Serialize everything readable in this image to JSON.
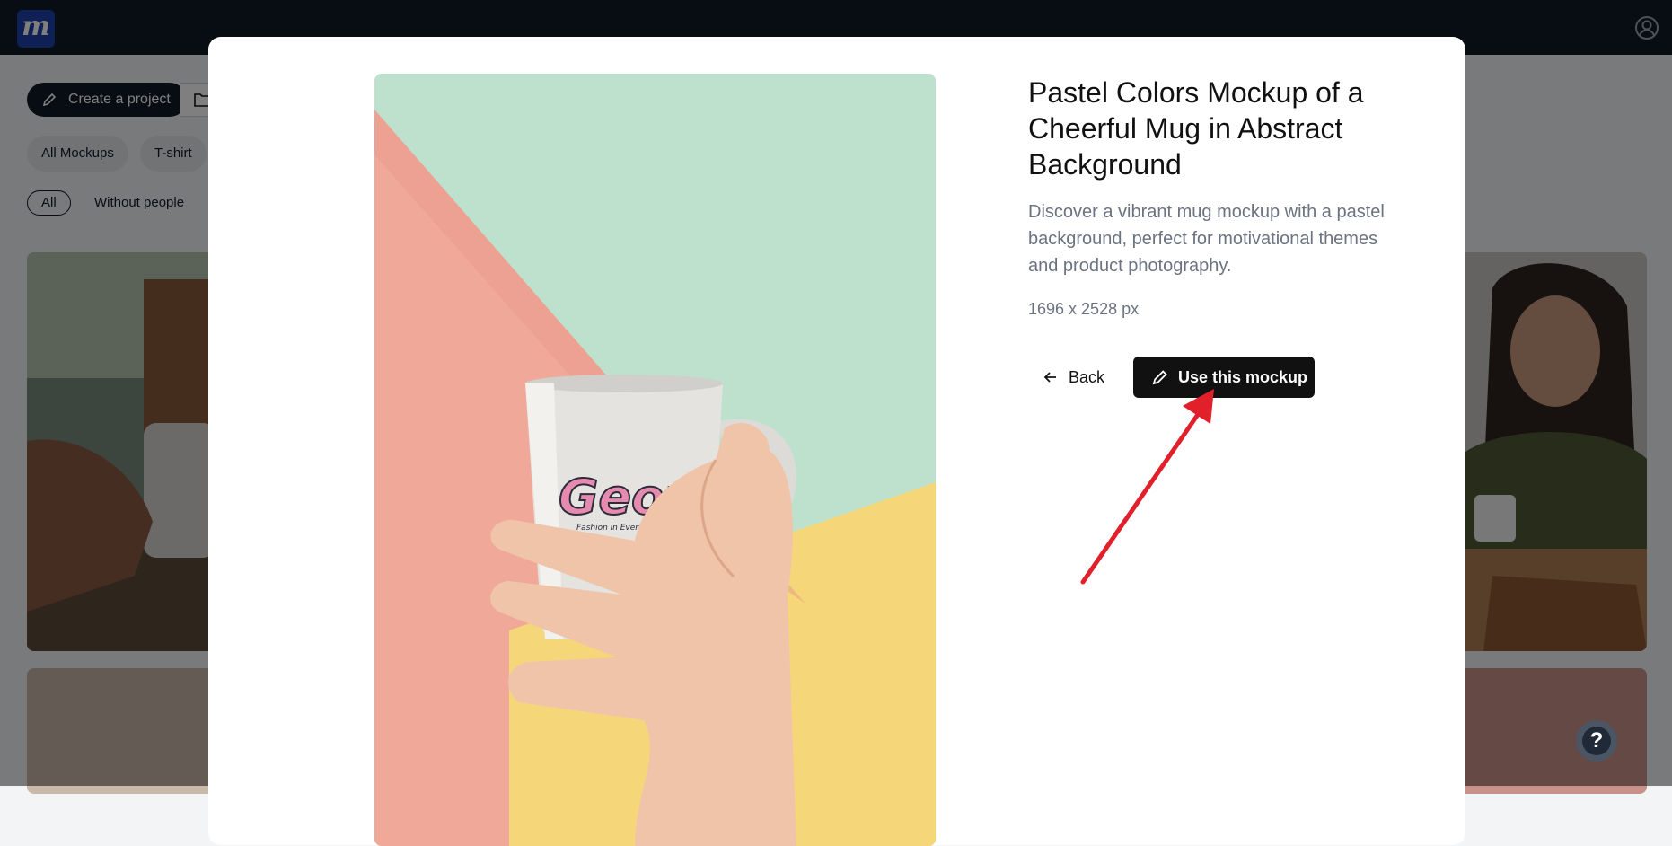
{
  "toolbar": {
    "create_project_label": "Create a project"
  },
  "categories": [
    {
      "label": "All Mockups"
    },
    {
      "label": "T-shirt"
    }
  ],
  "filters": [
    {
      "label": "All",
      "active": true
    },
    {
      "label": "Without people",
      "active": false
    }
  ],
  "modal": {
    "title": "Pastel Colors Mockup of a Cheerful Mug in Abstract Background",
    "description": "Discover a vibrant mug mockup with a pastel background, perfect for motivational themes and product photography.",
    "dimensions": "1696 x 2528 px",
    "back_label": "Back",
    "use_label": "Use this mockup",
    "preview_image": {
      "mug_logo_text": "Geow",
      "mug_tagline": "Fashion in Every Detail"
    }
  },
  "help": {
    "label": "?"
  },
  "colors": {
    "topbar": "#111827",
    "logo": "#1e40af",
    "primary_button": "#111111",
    "annotation_arrow": "#e0202a",
    "pastel_green": "#b9dec8",
    "pastel_pink": "#f0a898",
    "pastel_yellow": "#f5d77a"
  }
}
